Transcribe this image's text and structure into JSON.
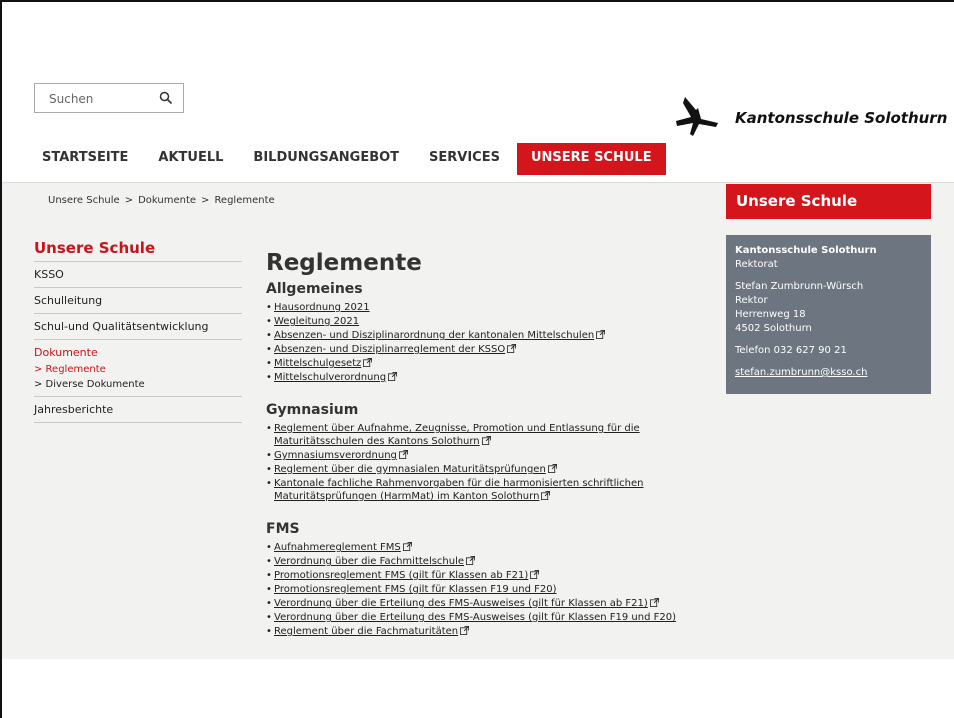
{
  "search": {
    "placeholder": "Suchen",
    "icon": "search-icon"
  },
  "brand": {
    "name": "Kantonsschule Solothurn",
    "logo": "ksso-logo"
  },
  "nav": [
    {
      "label": "STARTSEITE",
      "active": false
    },
    {
      "label": "AKTUELL",
      "active": false
    },
    {
      "label": "BILDUNGSANGEBOT",
      "active": false
    },
    {
      "label": "SERVICES",
      "active": false
    },
    {
      "label": "UNSERE SCHULE",
      "active": true
    }
  ],
  "breadcrumb": {
    "items": [
      "Unsere Schule",
      "Dokumente",
      "Reglemente"
    ],
    "separator": ">"
  },
  "sidebar": {
    "title": "Unsere Schule",
    "items": [
      "KSSO",
      "Schulleitung",
      "Schul-und Qualitätsentwicklung",
      "Dokumente"
    ],
    "subitems": [
      "> Reglemente",
      "> Diverse Dokumente"
    ],
    "last": "Jahresberichte"
  },
  "main": {
    "title": "Reglemente",
    "sections": [
      {
        "heading": "Allgemeines",
        "items": [
          {
            "text": "Hausordnung 2021",
            "external": false
          },
          {
            "text": "Wegleitung 2021",
            "external": false
          },
          {
            "text": "Absenzen- und Disziplinarordnung der kantonalen Mittelschulen",
            "external": true
          },
          {
            "text": "Absenzen- und Disziplinarreglement der KSSO",
            "external": true
          },
          {
            "text": "Mittelschulgesetz",
            "external": true
          },
          {
            "text": "Mittelschulverordnung",
            "external": true
          }
        ]
      },
      {
        "heading": "Gymnasium",
        "items": [
          {
            "text": "Reglement über Aufnahme, Zeugnisse, Promotion und Entlassung für die",
            "text2": "Maturitätsschulen des Kantons Solothurn",
            "external": true
          },
          {
            "text": "Gymnasiumsverordnung",
            "external": true
          },
          {
            "text": "Reglement über die gymnasialen Maturitätsprüfungen",
            "external": true
          },
          {
            "text": "Kantonale fachliche Rahmenvorgaben für die harmonisierten schriftlichen",
            "text2": "Maturitätsprüfungen (HarmMat) im Kanton Solothurn",
            "external": true
          }
        ]
      },
      {
        "heading": "FMS",
        "items": [
          {
            "text": "Aufnahmereglement FMS",
            "external": true
          },
          {
            "text": "Verordnung über die Fachmittelschule",
            "external": true
          },
          {
            "text": "Promotionsreglement FMS (gilt für Klassen ab F21)",
            "external": true
          },
          {
            "text": "Promotionsreglement FMS (gilt für Klassen F19 und F20)",
            "external": false
          },
          {
            "text": "Verordnung über die Erteilung des FMS-Ausweises (gilt für Klassen ab F21)",
            "external": true
          },
          {
            "text": "Verordnung über die Erteilung des FMS-Ausweises (gilt für Klassen F19 und F20)",
            "external": false
          },
          {
            "text": "Reglement über die Fachmaturitäten",
            "external": true
          }
        ]
      }
    ]
  },
  "right": {
    "heading": "Unsere Schule",
    "contact": {
      "org": "Kantonsschule Solothurn",
      "dept": "Rektorat",
      "person": "Stefan Zumbrunn-Würsch",
      "role": "Rektor",
      "street": "Herrenweg 18",
      "city": "4502 Solothurn",
      "phone": "Telefon 032 627 90 21",
      "email": "stefan.zumbrunn@ksso.ch"
    }
  },
  "colors": {
    "accent": "#d4151b",
    "contact_bg": "#6c7580",
    "content_bg": "#f2f2f0"
  }
}
